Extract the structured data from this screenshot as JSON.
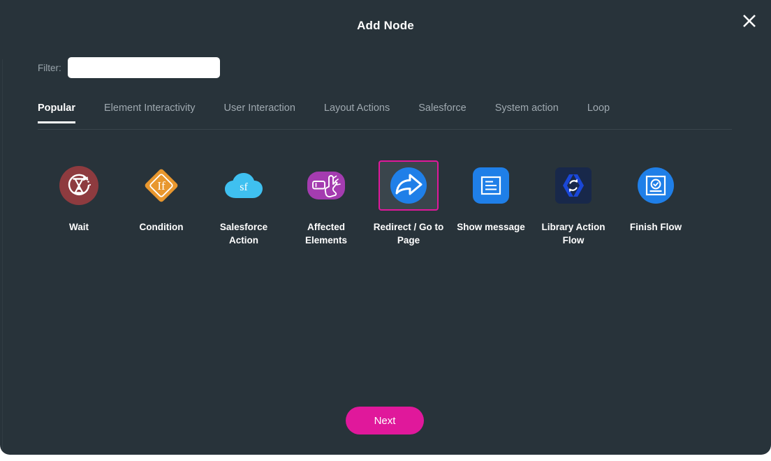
{
  "dialog": {
    "title": "Add Node",
    "close_icon": "close-icon"
  },
  "filter": {
    "label": "Filter:",
    "value": "",
    "placeholder": ""
  },
  "tabs": [
    {
      "label": "Popular",
      "active": true
    },
    {
      "label": "Element Interactivity",
      "active": false
    },
    {
      "label": "User Interaction",
      "active": false
    },
    {
      "label": "Layout Actions",
      "active": false
    },
    {
      "label": "Salesforce",
      "active": false
    },
    {
      "label": "System action",
      "active": false
    },
    {
      "label": "Loop",
      "active": false
    }
  ],
  "nodes": [
    {
      "label": "Wait",
      "icon": "wait-hourglass-icon",
      "selected": false
    },
    {
      "label": "Condition",
      "icon": "condition-diamond-if-icon",
      "selected": false
    },
    {
      "label": "Salesforce Action",
      "icon": "salesforce-cloud-icon",
      "selected": false
    },
    {
      "label": "Affected Elements",
      "icon": "affected-elements-hand-icon",
      "selected": false
    },
    {
      "label": "Redirect / Go to Page",
      "icon": "redirect-arrow-icon",
      "selected": true
    },
    {
      "label": "Show message",
      "icon": "show-message-document-icon",
      "selected": false
    },
    {
      "label": "Library Action Flow",
      "icon": "library-action-flow-code-icon",
      "selected": false
    },
    {
      "label": "Finish Flow",
      "icon": "finish-flow-check-icon",
      "selected": false
    }
  ],
  "footer": {
    "next_label": "Next"
  },
  "colors": {
    "modal_background": "#28333a",
    "accent_magenta": "#e0189b",
    "wait_red": "#8e3b3f",
    "condition_orange": "#e8972e",
    "salesforce_blue": "#3fc0f0",
    "affected_purple": "#a43cb0",
    "redirect_blue": "#1f7fe8",
    "show_message_blue": "#1f7fe8",
    "library_navy": "#18284a",
    "library_bracket_blue": "#1a47d8",
    "finish_blue": "#1f7fe8",
    "tab_inactive": "#9fa9b0",
    "tab_active": "#ffffff"
  }
}
